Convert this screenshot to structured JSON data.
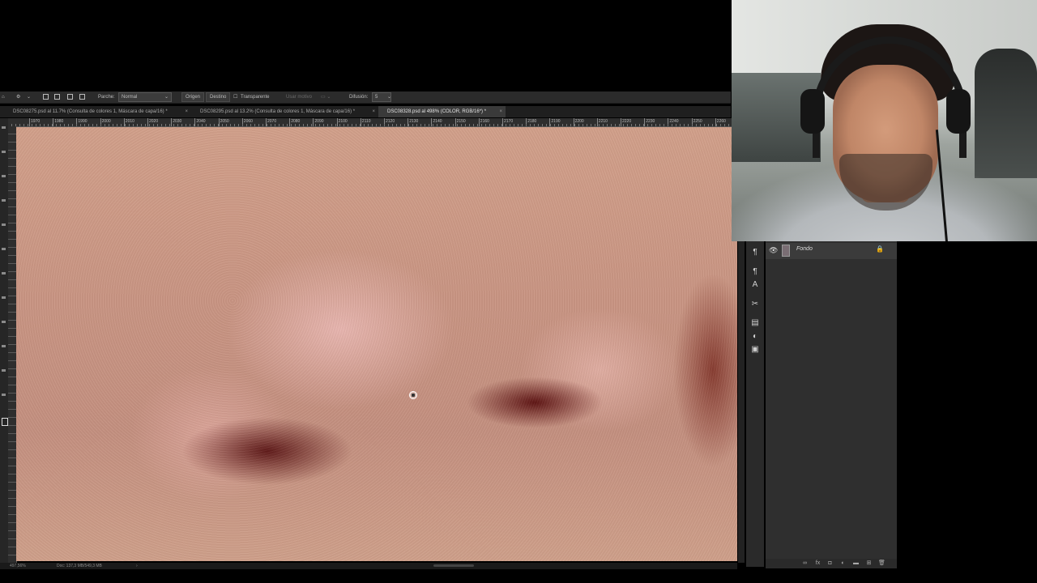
{
  "options_bar": {
    "patch_label": "Parche:",
    "patch_mode": "Normal",
    "source_label": "Origen",
    "destination_label": "Destino",
    "transparent_label": "Transparente",
    "use_pattern_label": "Usar motivo",
    "diffusion_label": "Difusión:",
    "diffusion_value": "5"
  },
  "tabs": [
    {
      "label": "DSC08275.psd al 11.7% (Consulta de colores 1, Máscara de capa/16) *",
      "close": "×",
      "active": false
    },
    {
      "label": "DSC08295.psd al 13.2% (Consulta de colores 1, Máscara de capa/16) *",
      "close": "×",
      "active": false
    },
    {
      "label": "DSC08328.psd al 498% (COLOR, RGB/16*) *",
      "close": "×",
      "active": true
    }
  ],
  "ruler_ticks": [
    "1970",
    "1980",
    "1990",
    "2000",
    "2010",
    "2020",
    "2030",
    "2040",
    "2050",
    "2060",
    "2070",
    "2080",
    "2090",
    "2100",
    "2110",
    "2120",
    "2130",
    "2140",
    "2150",
    "2160",
    "2170",
    "2180",
    "2190",
    "2200",
    "2210",
    "2220",
    "2230",
    "2240",
    "2250",
    "2260"
  ],
  "status_bar": {
    "zoom": "497,56%",
    "doc_info": "Doc: 137,3 MB/549,3 MB"
  },
  "layers_panel": {
    "layer_name": "Fondo",
    "layer_visible": true,
    "layer_locked": true
  },
  "right_icons": [
    "paragraph-icon",
    "character-style-icon",
    "text-icon",
    "scissors-icon",
    "layer-comps-icon",
    "adjustments-icon",
    "libraries-icon"
  ],
  "colors": {
    "panel_bg": "#2f2f2f",
    "tab_active_bg": "#3a3a3a",
    "skin_base": "#c99583"
  }
}
